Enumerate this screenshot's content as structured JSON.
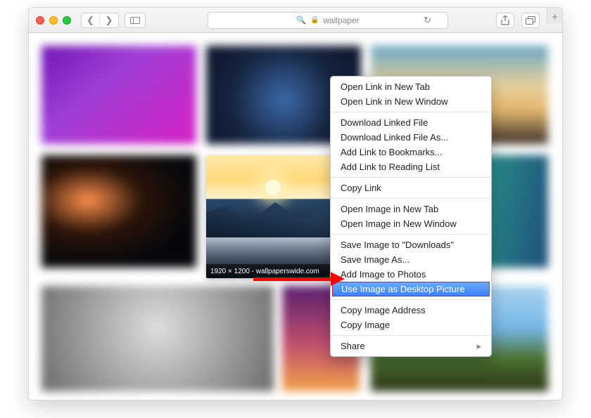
{
  "address_bar": {
    "query": "wallpaper"
  },
  "focused_image": {
    "caption": "1920 × 1200 - wallpaperswide.com"
  },
  "context_menu": {
    "group1": [
      "Open Link in New Tab",
      "Open Link in New Window"
    ],
    "group2": [
      "Download Linked File",
      "Download Linked File As...",
      "Add Link to Bookmarks...",
      "Add Link to Reading List"
    ],
    "group3": [
      "Copy Link"
    ],
    "group4": [
      "Open Image in New Tab",
      "Open Image in New Window"
    ],
    "group5": [
      "Save Image to \"Downloads\"",
      "Save Image As...",
      "Add Image to Photos"
    ],
    "highlighted": "Use Image as Desktop Picture",
    "group6": [
      "Copy Image Address",
      "Copy Image"
    ],
    "group7": [
      "Share"
    ]
  }
}
